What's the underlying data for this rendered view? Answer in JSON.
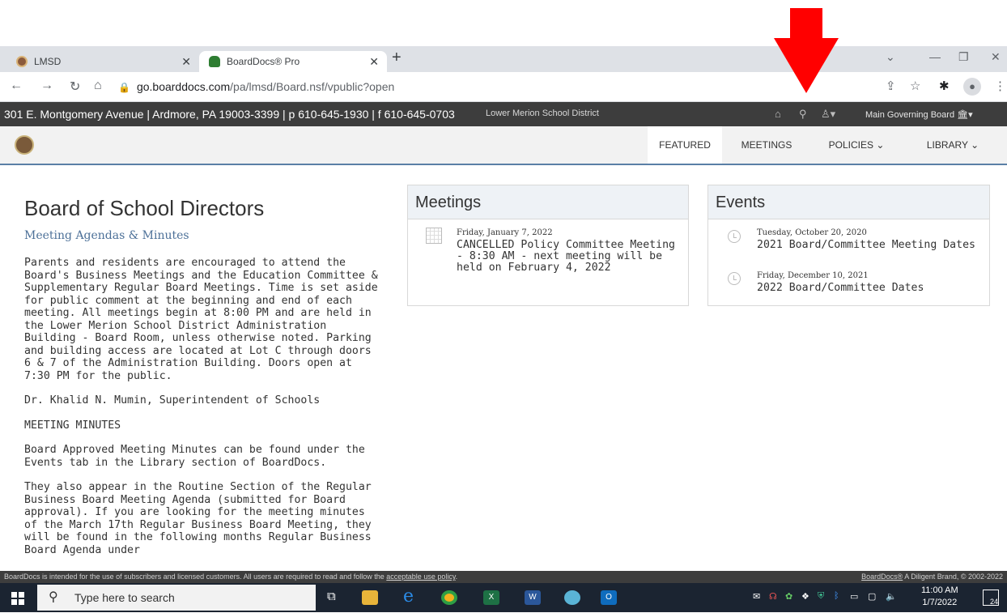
{
  "browser": {
    "tabs": [
      {
        "label": "LMSD",
        "active": false
      },
      {
        "label": "BoardDocs® Pro",
        "active": true
      }
    ],
    "url_host": "go.boarddocs.com",
    "url_path": "/pa/lmsd/Board.nsf/vpublic?open"
  },
  "site": {
    "address_line": "301 E. Montgomery Avenue | Ardmore, PA 19003-3399 | p 610-645-1930 | f 610-645-0703",
    "district_name": "Lower Merion School District",
    "board_selector": "Main Governing Board",
    "nav": {
      "featured": "FEATURED",
      "meetings": "MEETINGS",
      "policies": "POLICIES",
      "library": "LIBRARY"
    }
  },
  "main": {
    "title": "Board of School Directors",
    "subtitle": "Meeting Agendas & Minutes",
    "paragraphs": [
      "Parents and residents are encouraged to attend the Board's Business Meetings and the Education Committee & Supplementary Regular Board Meetings. Time is set aside for public comment at the beginning and end of each meeting. All meetings begin at 8:00 PM and are held in the Lower Merion School District Administration Building - Board Room, unless otherwise noted. Parking and building access are located at Lot C through doors 6 & 7 of the Administration Building. Doors open at 7:30 PM for the public.",
      "Dr. Khalid N. Mumin, Superintendent of Schools",
      "MEETING MINUTES",
      "Board Approved Meeting Minutes can be found under the Events tab in the Library section of BoardDocs.",
      "They also appear in the Routine Section of the Regular Business Board Meeting Agenda (submitted for Board approval). If you are looking for the meeting minutes of the March 17th Regular Business Board Meeting, they will be found in the following months Regular Business Board Agenda under"
    ]
  },
  "meetings_panel": {
    "heading": "Meetings",
    "items": [
      {
        "date": "Friday, January 7, 2022",
        "title": "CANCELLED Policy Committee Meeting - 8:30 AM - next meeting will be held on February 4, 2022"
      }
    ]
  },
  "events_panel": {
    "heading": "Events",
    "items": [
      {
        "date": "Tuesday, October 20, 2020",
        "title": "2021 Board/Committee Meeting Dates"
      },
      {
        "date": "Friday, December 10, 2021",
        "title": "2022 Board/Committee Dates"
      }
    ]
  },
  "footer": {
    "notice": "BoardDocs is intended for the use of subscribers and licensed customers. All users are required to read and follow the",
    "policy_link": "acceptable use policy",
    "policy_end": ".",
    "brand_link": "BoardDocs®",
    "brand_rest": " A Diligent Brand, © 2002-2022"
  },
  "taskbar": {
    "search_placeholder": "Type here to search",
    "time": "11:00 AM",
    "date": "1/7/2022",
    "notification_count": "24"
  },
  "colors": {
    "annotation_arrow": "#ff0000",
    "site_bar": "#3d3d3d",
    "link_blue": "#4c7098"
  }
}
